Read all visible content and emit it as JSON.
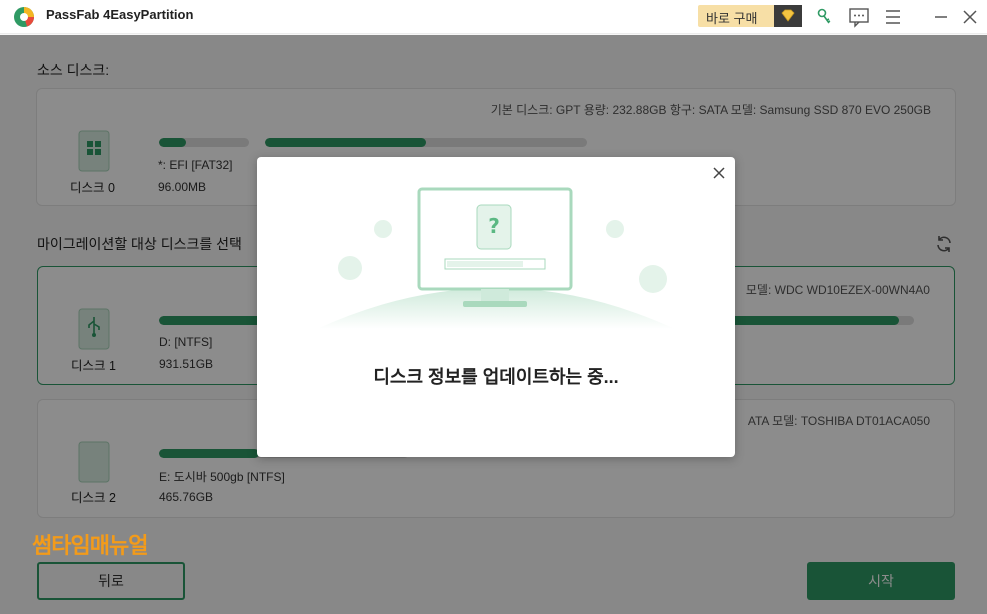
{
  "app": {
    "title": "PassFab 4EasyPartition",
    "buy_label": "바로 구매"
  },
  "titlebar_icons": [
    "key-icon",
    "feedback-icon",
    "menu-icon",
    "minimize-icon",
    "close-icon"
  ],
  "source": {
    "label": "소스 디스크:",
    "disk": {
      "name": "디스크 0",
      "meta": "기본 디스크: GPT    용량: 232.88GB    항구: SATA    모델: Samsung SSD 870 EVO 250GB",
      "partition_label": "*: EFI [FAT32]",
      "partition_size": "96.00MB",
      "bar1_fraction": 0.3,
      "bar2_fraction": 0.5
    }
  },
  "target": {
    "label": "마이그레이션할 대상 디스크를 선택",
    "disks": [
      {
        "name": "디스크 1",
        "meta": "모델: WDC WD10EZEX-00WN4A0",
        "partition_label": "D:  [NTFS]",
        "partition_size": "931.51GB",
        "selected": true,
        "bar_fraction": 0.98
      },
      {
        "name": "디스크 2",
        "meta": "ATA    모델: TOSHIBA DT01ACA050",
        "partition_label": "E: 도시바 500gb [NTFS]",
        "partition_size": "465.76GB",
        "selected": false,
        "bar_fraction": 0.4
      }
    ]
  },
  "watermark": "썸타임매뉴얼",
  "buttons": {
    "back": "뒤로",
    "start": "시작"
  },
  "modal": {
    "message": "디스크 정보를 업데이트하는 중..."
  },
  "colors": {
    "accent": "#2f9a64",
    "buy_bg": "#f7dfa6",
    "watermark": "#f39b1a"
  }
}
